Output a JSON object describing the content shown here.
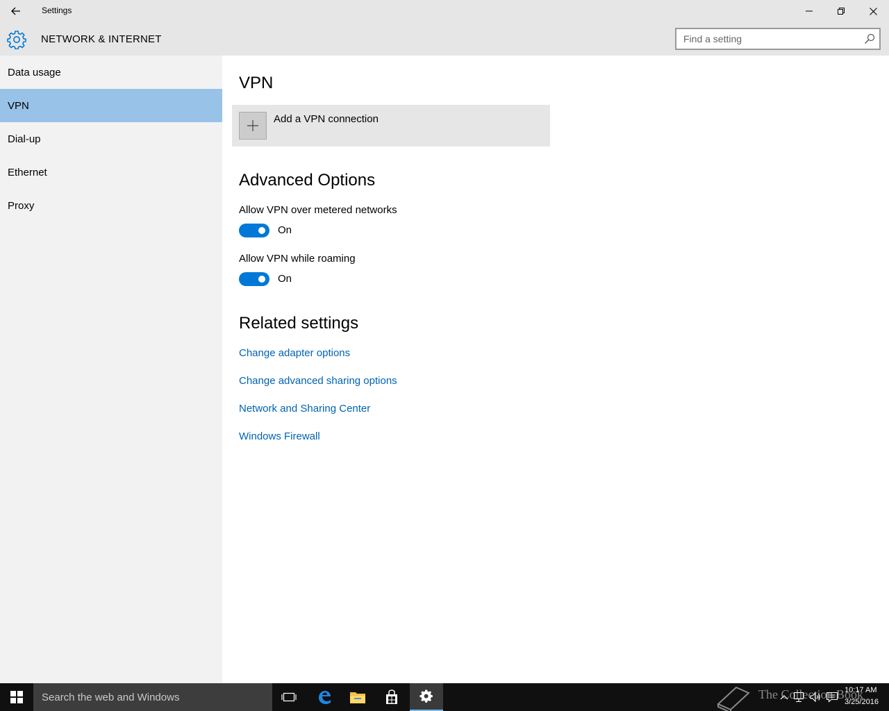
{
  "window": {
    "title": "Settings",
    "controls": {
      "minimize": "minimize-icon",
      "maximize": "restore-icon",
      "close": "close-icon"
    }
  },
  "header": {
    "section_title": "NETWORK & INTERNET",
    "search_placeholder": "Find a setting"
  },
  "sidebar": {
    "items": [
      {
        "label": "Data usage",
        "selected": false
      },
      {
        "label": "VPN",
        "selected": true
      },
      {
        "label": "Dial-up",
        "selected": false
      },
      {
        "label": "Ethernet",
        "selected": false
      },
      {
        "label": "Proxy",
        "selected": false
      }
    ]
  },
  "main": {
    "vpn_heading": "VPN",
    "add_vpn_label": "Add a VPN connection",
    "advanced_heading": "Advanced Options",
    "options": [
      {
        "label": "Allow VPN over metered networks",
        "state": "On",
        "on": true
      },
      {
        "label": "Allow VPN while roaming",
        "state": "On",
        "on": true
      }
    ],
    "related_heading": "Related settings",
    "links": [
      "Change adapter options",
      "Change advanced sharing options",
      "Network and Sharing Center",
      "Windows Firewall"
    ]
  },
  "taskbar": {
    "search_placeholder": "Search the web and Windows",
    "watermark": "The Collection Book",
    "time": "10:17 AM",
    "date": "3/25/2016"
  },
  "colors": {
    "accent": "#0078d7",
    "selected_nav": "#99c2e8",
    "link": "#0063b1",
    "chrome": "#e6e6e6",
    "sidebar": "#f2f2f2"
  }
}
